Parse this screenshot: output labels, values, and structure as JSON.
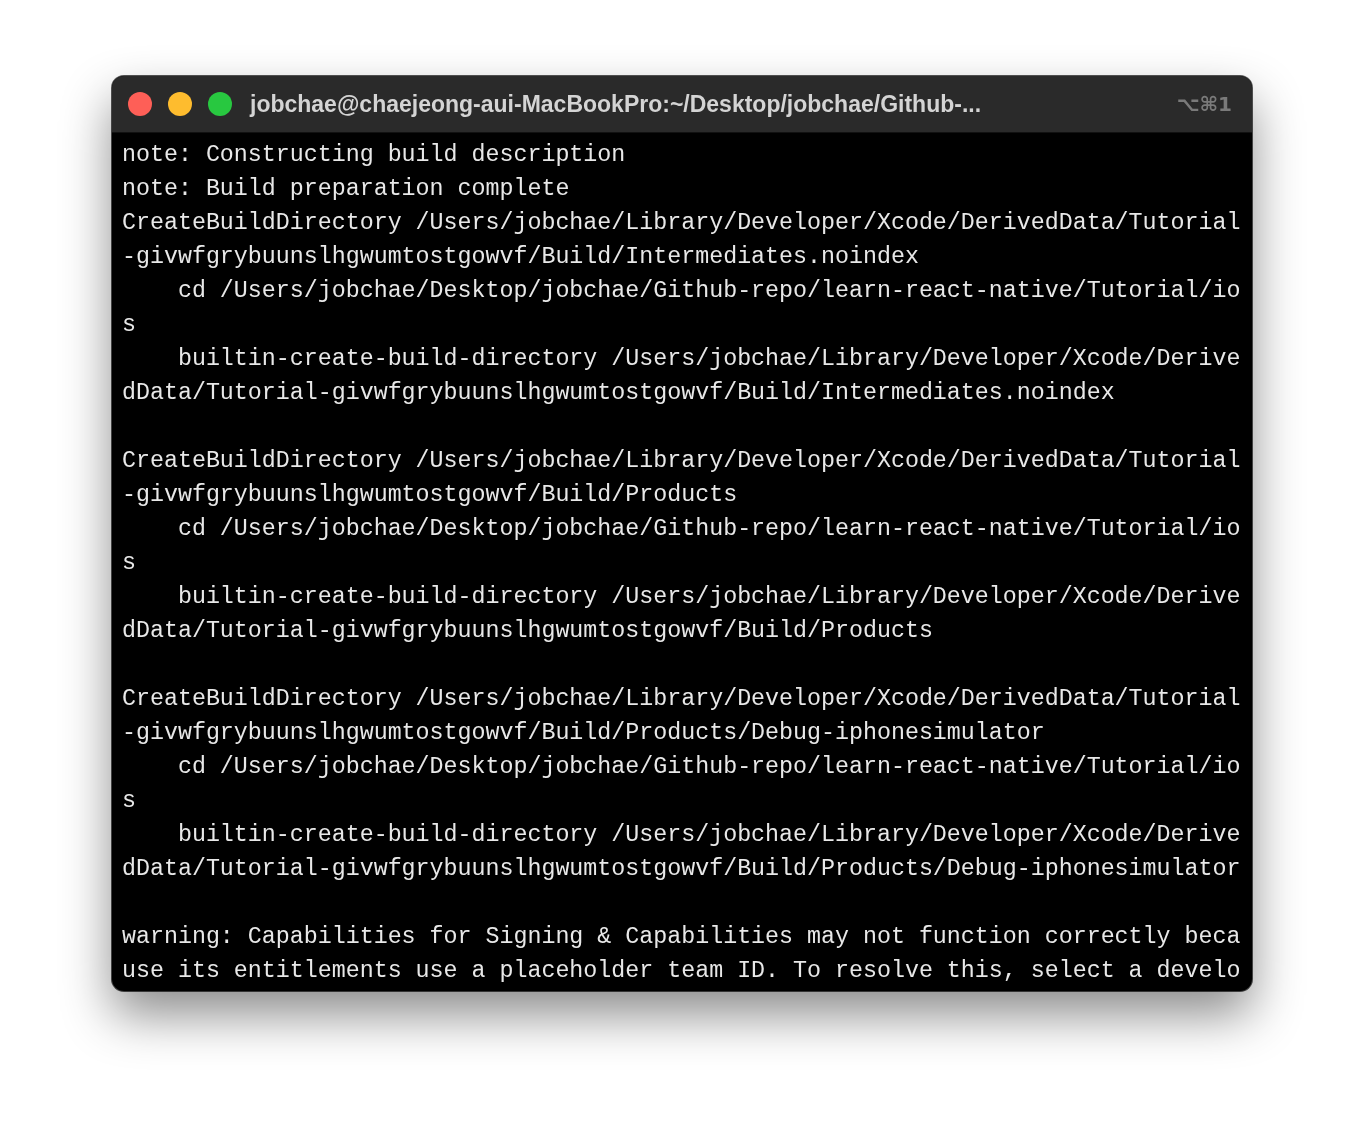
{
  "window": {
    "title": "jobchae@chaejeong-aui-MacBookPro:~/Desktop/jobchae/Github-...",
    "shortcut": "⌥⌘1"
  },
  "output_blocks": [
    {
      "lines": [
        "note: Constructing build description",
        "note: Build preparation complete",
        "CreateBuildDirectory /Users/jobchae/Library/Developer/Xcode/DerivedData/Tutorial",
        "-givwfgrybuunslhgwumtostgowvf/Build/Intermediates.noindex",
        "    cd /Users/jobchae/Desktop/jobchae/Github-repo/learn-react-native/Tutorial/io",
        "s",
        "    builtin-create-build-directory /Users/jobchae/Library/Developer/Xcode/Derive",
        "dData/Tutorial-givwfgrybuunslhgwumtostgowvf/Build/Intermediates.noindex"
      ]
    },
    {
      "lines": [
        "CreateBuildDirectory /Users/jobchae/Library/Developer/Xcode/DerivedData/Tutorial",
        "-givwfgrybuunslhgwumtostgowvf/Build/Products",
        "    cd /Users/jobchae/Desktop/jobchae/Github-repo/learn-react-native/Tutorial/io",
        "s",
        "    builtin-create-build-directory /Users/jobchae/Library/Developer/Xcode/Derive",
        "dData/Tutorial-givwfgrybuunslhgwumtostgowvf/Build/Products"
      ]
    },
    {
      "lines": [
        "CreateBuildDirectory /Users/jobchae/Library/Developer/Xcode/DerivedData/Tutorial",
        "-givwfgrybuunslhgwumtostgowvf/Build/Products/Debug-iphonesimulator",
        "    cd /Users/jobchae/Desktop/jobchae/Github-repo/learn-react-native/Tutorial/io",
        "s",
        "    builtin-create-build-directory /Users/jobchae/Library/Developer/Xcode/Derive",
        "dData/Tutorial-givwfgrybuunslhgwumtostgowvf/Build/Products/Debug-iphonesimulator"
      ]
    },
    {
      "lines": [
        "warning: Capabilities for Signing & Capabilities may not function correctly beca",
        "use its entitlements use a placeholder team ID. To resolve this, select a develo"
      ]
    }
  ]
}
